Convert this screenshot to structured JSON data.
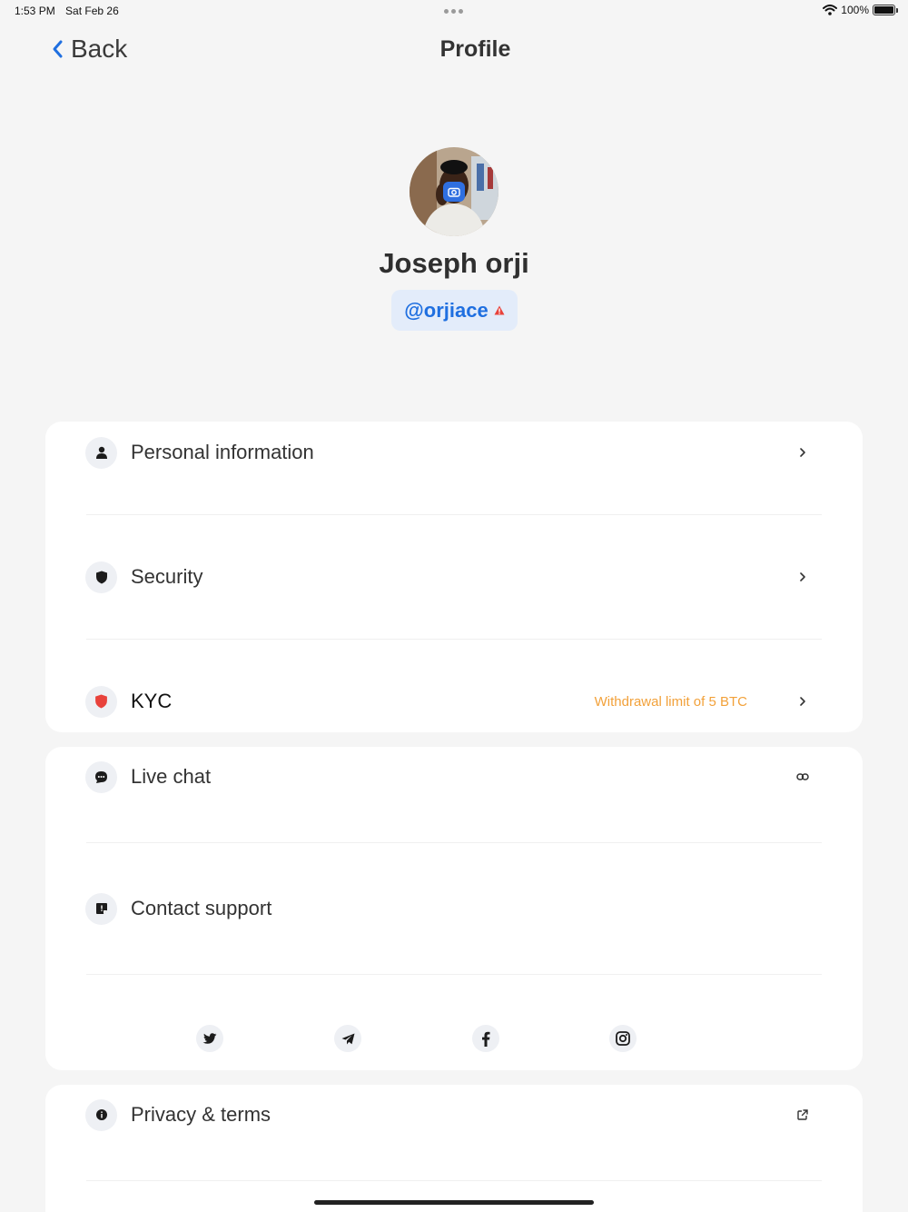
{
  "status_bar": {
    "time": "1:53 PM",
    "date": "Sat Feb 26",
    "battery": "100%"
  },
  "nav": {
    "back_label": "Back",
    "title": "Profile"
  },
  "profile": {
    "name": "Joseph orji",
    "username": "@orjiace"
  },
  "account_section": {
    "items": [
      {
        "label": "Personal information",
        "icon": "person-icon",
        "action_icon": "chevron-right-icon"
      },
      {
        "label": "Security",
        "icon": "shield-icon",
        "action_icon": "chevron-right-icon"
      },
      {
        "label": "KYC",
        "icon": "shield-red-icon",
        "note": "Withdrawal limit of 5 BTC",
        "action_icon": "chevron-right-icon"
      }
    ]
  },
  "support_section": {
    "items": [
      {
        "label": "Live chat",
        "icon": "chat-bubble-icon",
        "action_icon": "link-icon"
      },
      {
        "label": "Contact support",
        "icon": "support-note-icon"
      }
    ],
    "socials": [
      "twitter-icon",
      "telegram-icon",
      "facebook-icon",
      "instagram-icon"
    ]
  },
  "legal_section": {
    "items": [
      {
        "label": "Privacy & terms",
        "icon": "info-icon",
        "action_icon": "external-link-icon"
      }
    ]
  },
  "colors": {
    "accent_blue": "#1f6fe0",
    "warning_red": "#e8423b",
    "kyc_note_orange": "#f2a13a",
    "background": "#f5f5f5",
    "card": "#ffffff"
  }
}
